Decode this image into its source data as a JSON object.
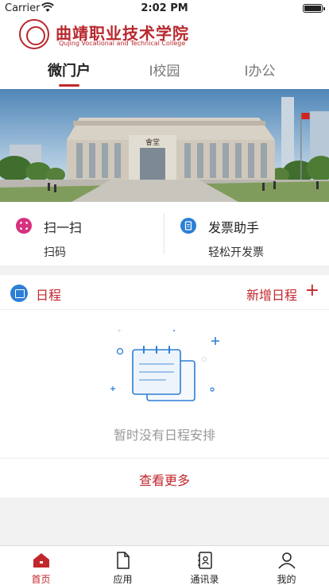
{
  "status_bar": {
    "carrier": "Carrier",
    "time": "2:02 PM",
    "battery_level": 1.0
  },
  "header": {
    "logo_cn": "曲靖职业技术学院",
    "logo_en": "Qujing Vocational and Technical College"
  },
  "tabs": [
    {
      "label": "微门户",
      "active": true
    },
    {
      "label": "I校园",
      "active": false
    },
    {
      "label": "I办公",
      "active": false
    }
  ],
  "banner": {
    "plaque_text": "會堂"
  },
  "quick": [
    {
      "title": "扫一扫",
      "subtitle": "扫码",
      "icon": "scan-icon",
      "color": "#d6317f"
    },
    {
      "title": "发票助手",
      "subtitle": "轻松开发票",
      "icon": "invoice-icon",
      "color": "#2b7fd6"
    }
  ],
  "schedule": {
    "title": "日程",
    "add_label": "新增日程",
    "empty_text": "暂时没有日程安排",
    "more_label": "查看更多"
  },
  "tabbar": [
    {
      "label": "首页",
      "icon": "home-icon",
      "active": true
    },
    {
      "label": "应用",
      "icon": "document-icon",
      "active": false
    },
    {
      "label": "通讯录",
      "icon": "contacts-icon",
      "active": false
    },
    {
      "label": "我的",
      "icon": "user-icon",
      "active": false
    }
  ],
  "colors": {
    "accent": "#c1272d",
    "blue": "#2b7fd6",
    "pink": "#d6317f"
  }
}
